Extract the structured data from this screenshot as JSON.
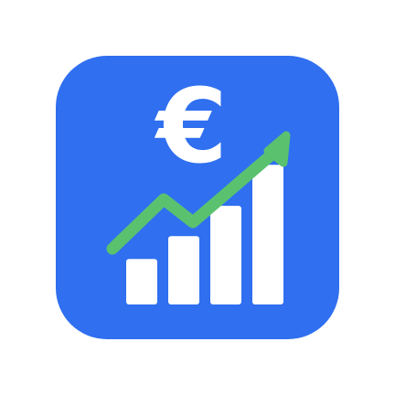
{
  "icon": {
    "symbol": "€",
    "symbol_meaning": "euro-sign",
    "icon_names": [
      "euro-icon",
      "trend-arrow-icon",
      "bar-chart-icon"
    ],
    "colors": {
      "tile": "#2f6ff0",
      "symbol": "#ffffff",
      "bars": "#ffffff",
      "trend_line": "#5ac26f"
    },
    "bar_levels": [
      0.3,
      0.45,
      0.65,
      0.92
    ]
  }
}
